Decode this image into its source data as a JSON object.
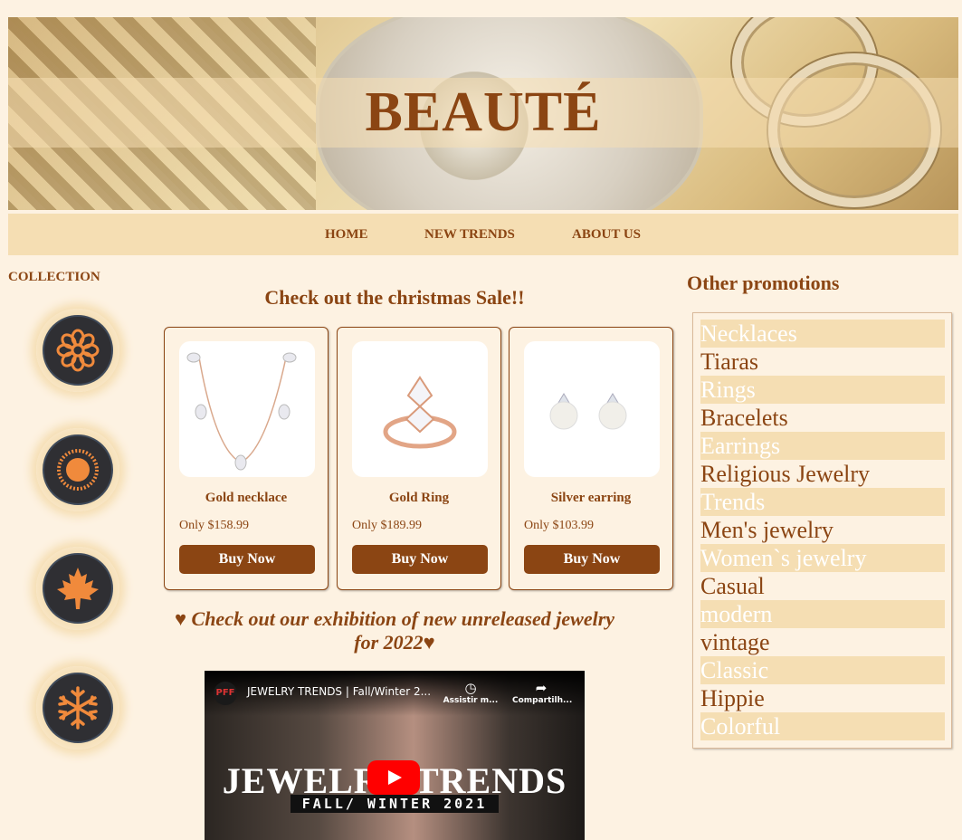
{
  "banner": {
    "title": "BEAUTÉ"
  },
  "nav": {
    "items": [
      "HOME",
      "NEW TRENDS",
      "ABOUT US"
    ]
  },
  "collection": {
    "title": "COLLECTION",
    "icons": [
      "flower-icon",
      "sun-icon",
      "maple-leaf-icon",
      "snowflake-icon"
    ]
  },
  "sale": {
    "title": "Check out the christmas Sale!!",
    "products": [
      {
        "name": "Gold necklace",
        "price": "Only $158.99",
        "button": "Buy Now"
      },
      {
        "name": "Gold Ring",
        "price": "Only $189.99",
        "button": "Buy Now"
      },
      {
        "name": "Silver earring",
        "price": "Only $103.99",
        "button": "Buy Now"
      }
    ]
  },
  "exhibition": {
    "line1": "♥ Check out our exhibition of new unreleased jewelry",
    "line2": "for 2022♥"
  },
  "video": {
    "channel_logo": "PFF",
    "title": "JEWELRY TRENDS | Fall/Winter 2...",
    "watch_later": "Assistir m...",
    "share": "Compartilh...",
    "overlay_title": "JEWELRY TRENDS",
    "overlay_sub": "FALL/ WINTER 2021"
  },
  "promotions": {
    "title": "Other promotions",
    "items": [
      "Necklaces",
      "Tiaras",
      "Rings",
      "Bracelets",
      "Earrings",
      "Religious Jewelry",
      "Trends",
      "Men's jewelry",
      "Women`s jewelry",
      "Casual",
      "modern",
      "vintage",
      "Classic",
      "Hippie",
      "Colorful"
    ]
  },
  "colors": {
    "accent": "#8b4513",
    "band": "#f5deb3",
    "background": "#fdf2e2"
  }
}
